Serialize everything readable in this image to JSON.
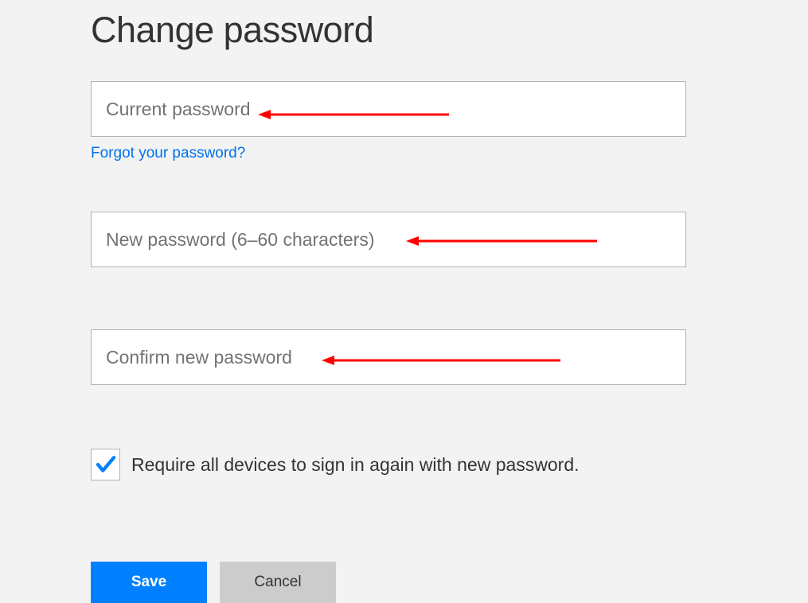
{
  "title": "Change password",
  "fields": {
    "current": {
      "placeholder": "Current password",
      "value": ""
    },
    "new": {
      "placeholder": "New password (6–60 characters)",
      "value": ""
    },
    "confirm": {
      "placeholder": "Confirm new password",
      "value": ""
    }
  },
  "forgot_link": "Forgot your password?",
  "checkbox": {
    "checked": true,
    "label": "Require all devices to sign in again with new password."
  },
  "buttons": {
    "save": "Save",
    "cancel": "Cancel"
  },
  "colors": {
    "primary": "#0080ff",
    "link": "#0071eb",
    "annotation": "#ff0000"
  }
}
